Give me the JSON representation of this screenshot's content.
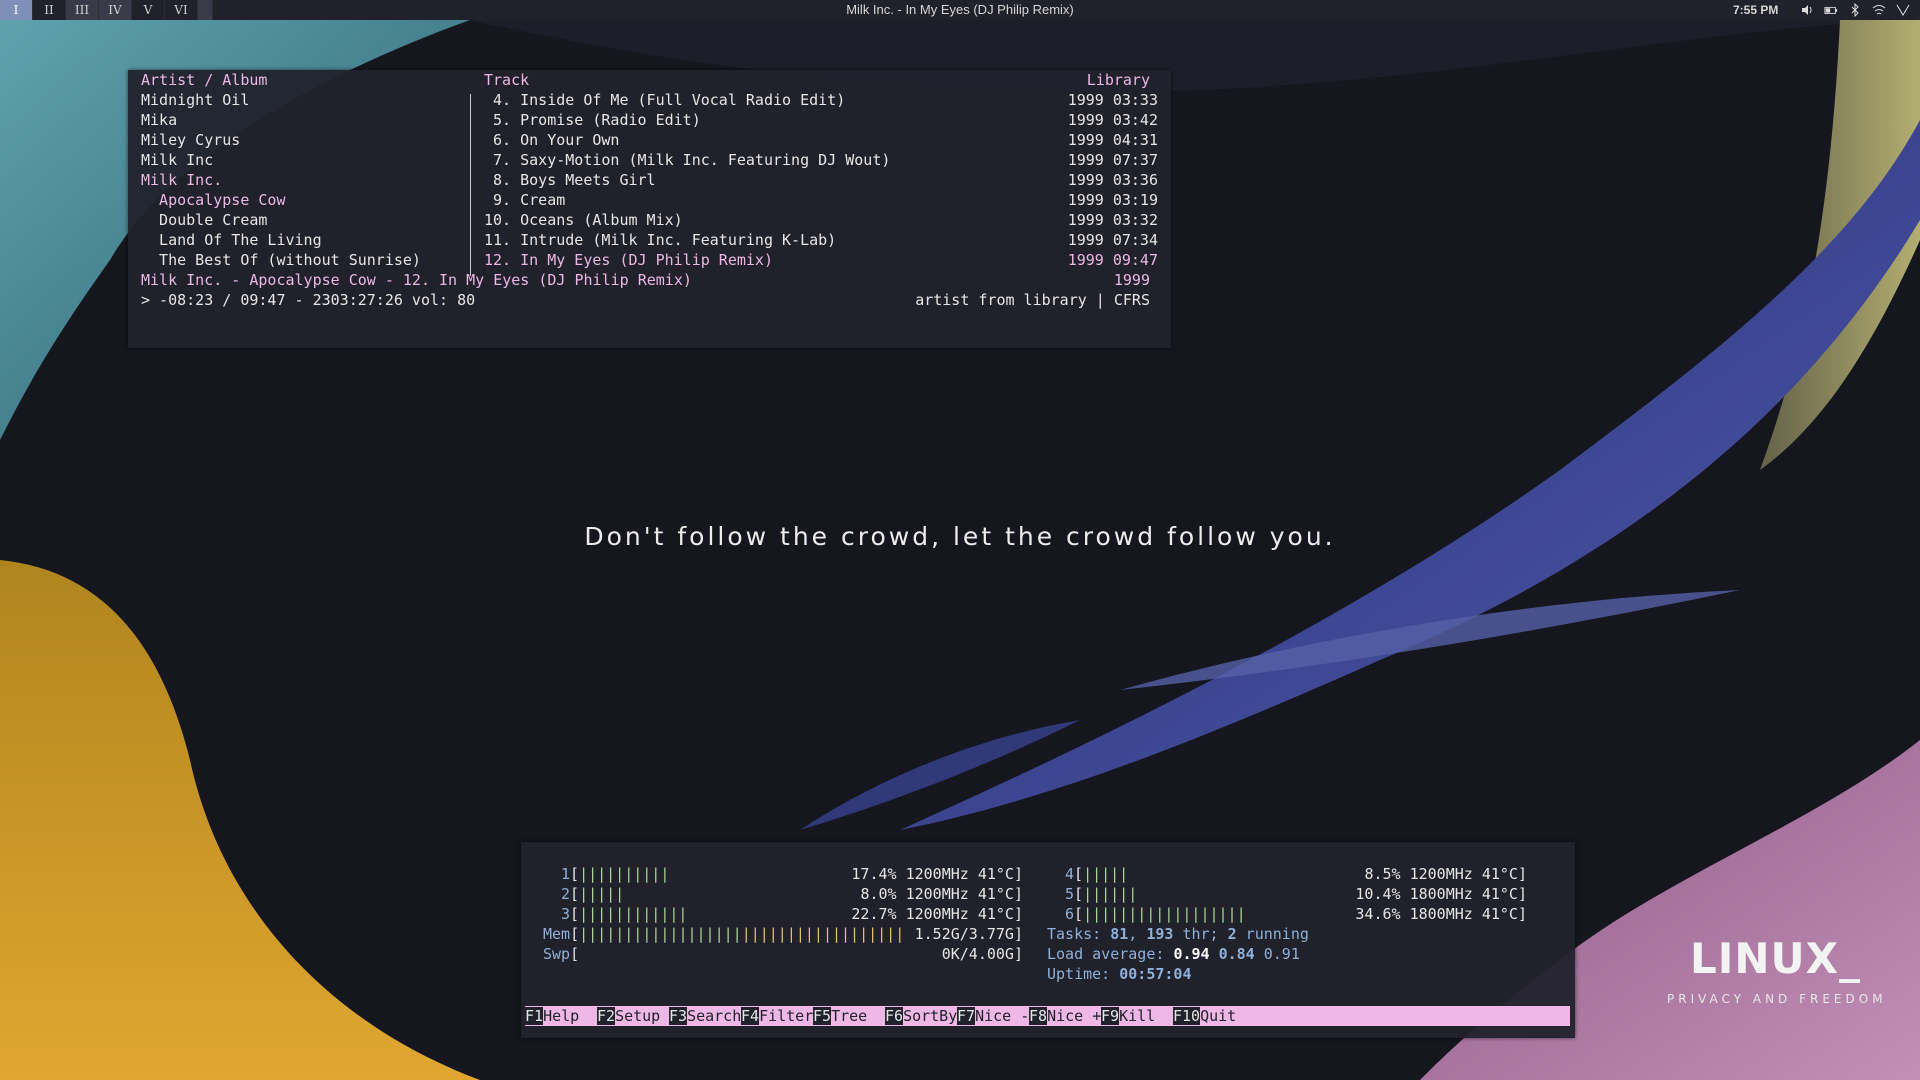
{
  "topbar": {
    "workspaces": [
      "I",
      "II",
      "III",
      "IV",
      "V",
      "VI",
      ""
    ],
    "window_title": "Milk Inc. - In My Eyes (DJ Philip Remix)",
    "clock": "7:55 PM",
    "tray_icons": [
      "volume-icon",
      "battery-icon",
      "bluetooth-icon",
      "wifi-icon",
      "network-icon"
    ]
  },
  "cmus": {
    "header_artist": "Artist / Album",
    "header_track": "Track",
    "header_library": "Library",
    "artists": [
      "Midnight Oil",
      "Mika",
      "Miley Cyrus",
      "Milk Inc",
      "Milk Inc.",
      "  Apocalypse Cow",
      "  Double Cream",
      "  Land Of The Living",
      "  The Best Of (without Sunrise)"
    ],
    "tracks": [
      {
        "title": " 4. Inside Of Me (Full Vocal Radio Edit)",
        "meta": "1999 03:33"
      },
      {
        "title": " 5. Promise (Radio Edit)",
        "meta": "1999 03:42"
      },
      {
        "title": " 6. On Your Own",
        "meta": "1999 04:31"
      },
      {
        "title": " 7. Saxy-Motion (Milk Inc. Featuring DJ Wout)",
        "meta": "1999 07:37"
      },
      {
        "title": " 8. Boys Meets Girl",
        "meta": "1999 03:36"
      },
      {
        "title": " 9. Cream",
        "meta": "1999 03:19"
      },
      {
        "title": "10. Oceans (Album Mix)",
        "meta": "1999 03:32"
      },
      {
        "title": "11. Intrude (Milk Inc. Featuring K-Lab)",
        "meta": "1999 07:34"
      },
      {
        "title": "12. In My Eyes (DJ Philip Remix)",
        "meta": "1999 09:47"
      }
    ],
    "now_playing": "Milk Inc. - Apocalypse Cow - 12. In My Eyes (DJ Philip Remix)",
    "now_playing_year": "1999",
    "status_line": "> -08:23 / 09:47 - 2303:27:26 vol: 80",
    "status_right": "artist from library | CFRS"
  },
  "htop": {
    "cpus_left": [
      {
        "label": "1",
        "bars": "||||||||||",
        "stats": "17.4% 1200MHz 41°C]"
      },
      {
        "label": "2",
        "bars": "|||||",
        "stats": "8.0% 1200MHz 41°C]"
      },
      {
        "label": "3",
        "bars": "||||||||||||",
        "stats": "22.7% 1200MHz 41°C]"
      }
    ],
    "cpus_right": [
      {
        "label": "4",
        "bars": "|||||",
        "stats": "8.5% 1200MHz 41°C]"
      },
      {
        "label": "5",
        "bars": "||||||",
        "stats": "10.4% 1800MHz 41°C]"
      },
      {
        "label": "6",
        "bars": "||||||||||||||||||",
        "stats": "34.6% 1800MHz 41°C]"
      }
    ],
    "mem": {
      "label": "Mem",
      "bars_green": "||||||||||||||||||",
      "bars_yellow": "||||||||||||||||||",
      "value": "1.52G/3.77G]"
    },
    "swp": {
      "label": "Swp",
      "value": "0K/4.00G]"
    },
    "tasks": {
      "label": "Tasks: ",
      "count": "81",
      "sep": ", ",
      "threads": "193",
      "thr_label": " thr; ",
      "running": "2",
      "running_label": " running"
    },
    "load": {
      "label": "Load average: ",
      "one": "0.94",
      "five": "0.84",
      "fifteen": "0.91"
    },
    "uptime": {
      "label": "Uptime: ",
      "value": "00:57:04"
    },
    "fkeys": [
      {
        "num": "F1",
        "label": "Help  "
      },
      {
        "num": "F2",
        "label": "Setup "
      },
      {
        "num": "F3",
        "label": "Search"
      },
      {
        "num": "F4",
        "label": "Filter"
      },
      {
        "num": "F5",
        "label": "Tree  "
      },
      {
        "num": "F6",
        "label": "SortBy"
      },
      {
        "num": "F7",
        "label": "Nice -"
      },
      {
        "num": "F8",
        "label": "Nice +"
      },
      {
        "num": "F9",
        "label": "Kill  "
      },
      {
        "num": "F10",
        "label": "Quit"
      }
    ]
  },
  "desktop": {
    "quote": "Don't follow the crowd, let the crowd follow you.",
    "logo_title": "LINUX_",
    "logo_subtitle": "PRIVACY AND FREEDOM"
  }
}
